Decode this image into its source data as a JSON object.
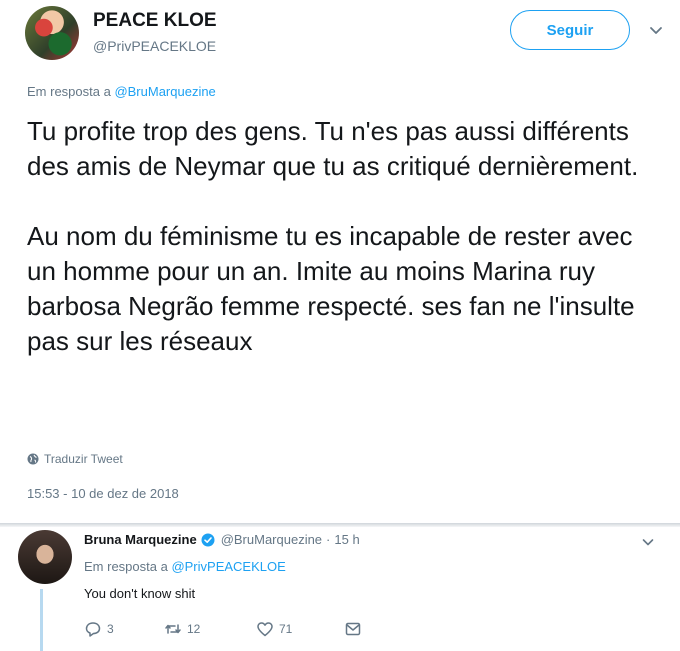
{
  "tweet": {
    "author_name": "PEACE KLOE",
    "author_handle": "@PrivPEACEKLOE",
    "follow_label": "Seguir",
    "reply_prefix": "Em resposta a ",
    "reply_mention": "@BruMarquezine",
    "paragraph1": "Tu profite trop des gens. Tu n'es pas aussi différents des amis de Neymar que tu as critiqué dernièrement.",
    "paragraph2": "Au nom du féminisme tu es incapable de rester avec un homme pour un an. Imite au moins Marina ruy barbosa Negrão femme respecté. ses fan ne l'insulte pas sur les réseaux",
    "translate_label": "Traduzir Tweet",
    "timestamp": "15:53 - 10 de dez de 2018"
  },
  "reply": {
    "author_name": "Bruna Marquezine",
    "author_handle": "@BruMarquezine",
    "separator": "·",
    "time": "15 h",
    "reply_prefix": "Em resposta a ",
    "reply_mention": "@PrivPEACEKLOE",
    "text": "You don't know shit",
    "reply_count": "3",
    "retweet_count": "12",
    "like_count": "71"
  },
  "colors": {
    "accent": "#1da1f2",
    "muted": "#657786",
    "text": "#14171a",
    "thread_line": "#b7d9f0"
  },
  "icons": [
    "chevron-down-icon",
    "globe-icon",
    "verified-icon",
    "reply-icon",
    "retweet-icon",
    "like-icon",
    "message-icon"
  ]
}
